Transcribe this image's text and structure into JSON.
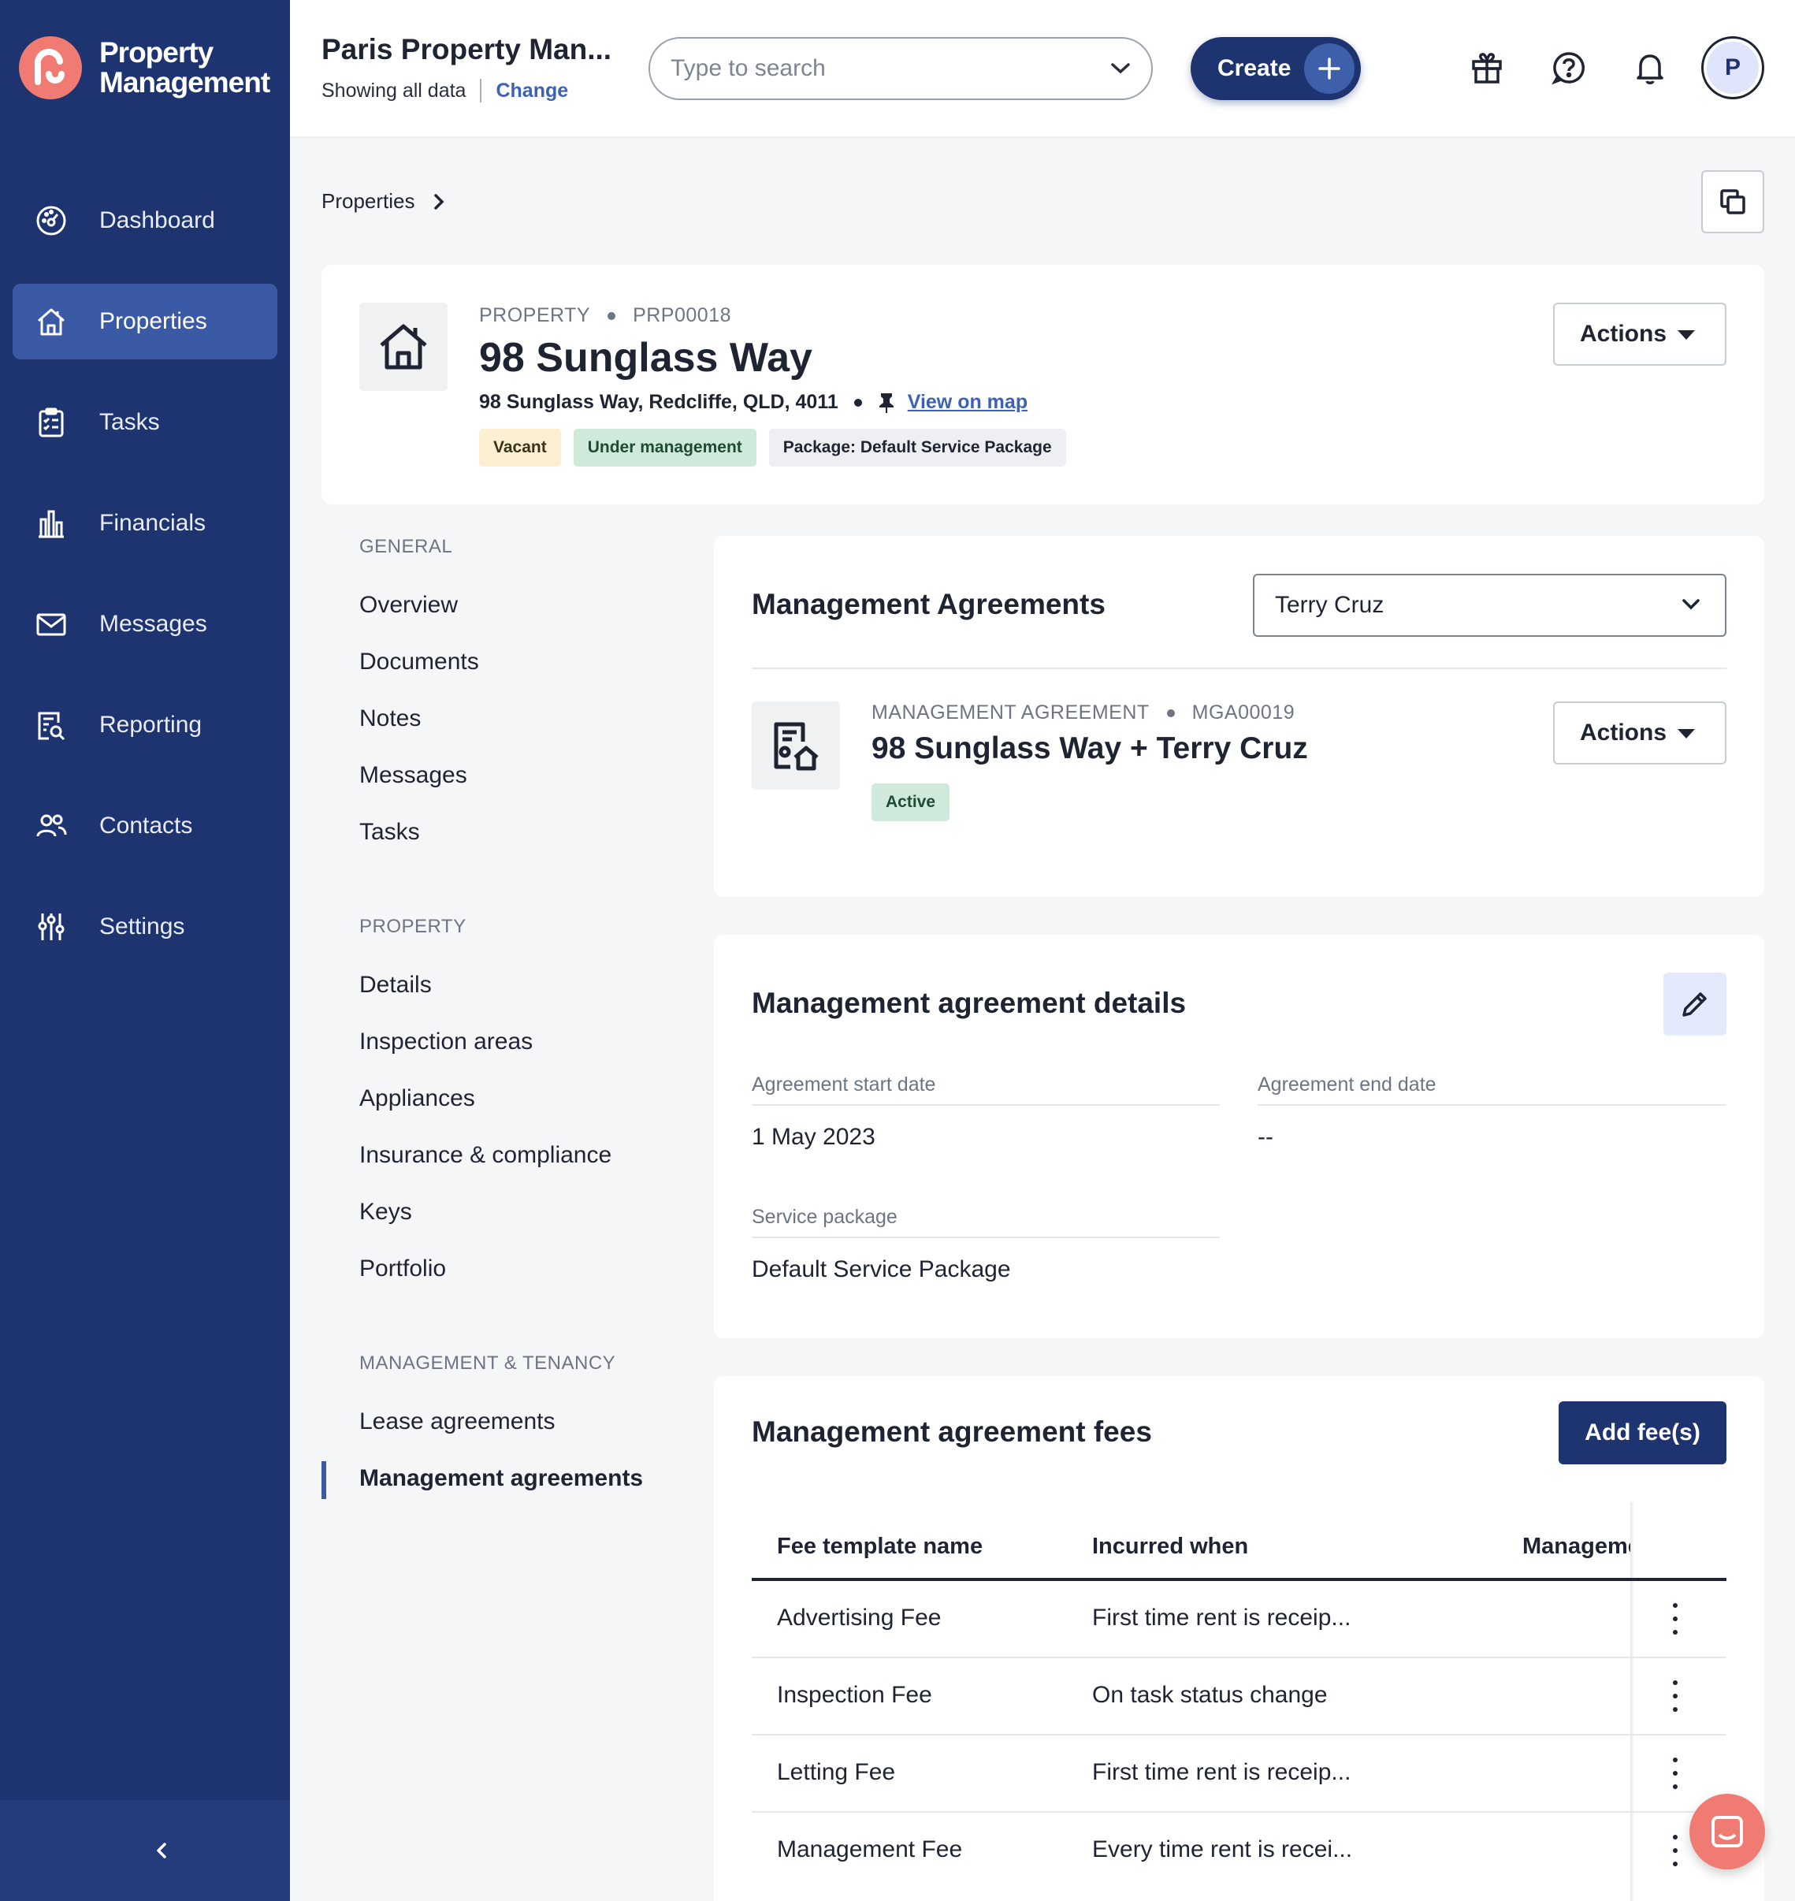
{
  "app": {
    "logo_line1": "Property",
    "logo_line2": "Management",
    "accent": "#f07b72",
    "brand": "#1e3470"
  },
  "sidebar": {
    "items": [
      {
        "label": "Dashboard",
        "icon": "dashboard-icon"
      },
      {
        "label": "Properties",
        "icon": "home-icon",
        "active": true
      },
      {
        "label": "Tasks",
        "icon": "clipboard-icon"
      },
      {
        "label": "Financials",
        "icon": "bank-icon"
      },
      {
        "label": "Messages",
        "icon": "mail-icon"
      },
      {
        "label": "Reporting",
        "icon": "report-icon"
      },
      {
        "label": "Contacts",
        "icon": "contacts-icon"
      },
      {
        "label": "Settings",
        "icon": "sliders-icon"
      }
    ]
  },
  "topbar": {
    "org_title": "Paris Property Man...",
    "showing": "Showing all data",
    "change": "Change",
    "search_placeholder": "Type to search",
    "create_label": "Create",
    "avatar_initial": "P"
  },
  "breadcrumb": {
    "root": "Properties"
  },
  "property": {
    "overline_type": "PROPERTY",
    "overline_id": "PRP00018",
    "title": "98 Sunglass Way",
    "address": "98 Sunglass Way, Redcliffe, QLD, 4011",
    "map_link": "View on map",
    "badges": [
      "Vacant",
      "Under management",
      "Package: Default Service Package"
    ],
    "actions_label": "Actions"
  },
  "subnav": {
    "general_head": "GENERAL",
    "general": [
      "Overview",
      "Documents",
      "Notes",
      "Messages",
      "Tasks"
    ],
    "property_head": "PROPERTY",
    "property": [
      "Details",
      "Inspection areas",
      "Appliances",
      "Insurance & compliance",
      "Keys",
      "Portfolio"
    ],
    "tenancy_head": "MANAGEMENT & TENANCY",
    "tenancy": [
      "Lease agreements",
      "Management agreements"
    ]
  },
  "agreements": {
    "title": "Management Agreements",
    "selected_owner": "Terry Cruz",
    "overline_type": "MANAGEMENT AGREEMENT",
    "overline_id": "MGA00019",
    "agreement_title": "98 Sunglass Way + Terry Cruz",
    "status": "Active",
    "actions_label": "Actions"
  },
  "details": {
    "title": "Management agreement details",
    "start_label": "Agreement start date",
    "start_value": "1 May 2023",
    "end_label": "Agreement end date",
    "end_value": "--",
    "package_label": "Service package",
    "package_value": "Default Service Package"
  },
  "fees": {
    "title": "Management agreement fees",
    "add_label": "Add fee(s)",
    "columns": [
      "Fee template name",
      "Incurred when",
      "Manageme"
    ],
    "rows": [
      {
        "name": "Advertising Fee",
        "when": "First time rent is receip..."
      },
      {
        "name": "Inspection Fee",
        "when": "On task status change"
      },
      {
        "name": "Letting Fee",
        "when": "First time rent is receip..."
      },
      {
        "name": "Management Fee",
        "when": "Every time rent is recei..."
      }
    ]
  }
}
